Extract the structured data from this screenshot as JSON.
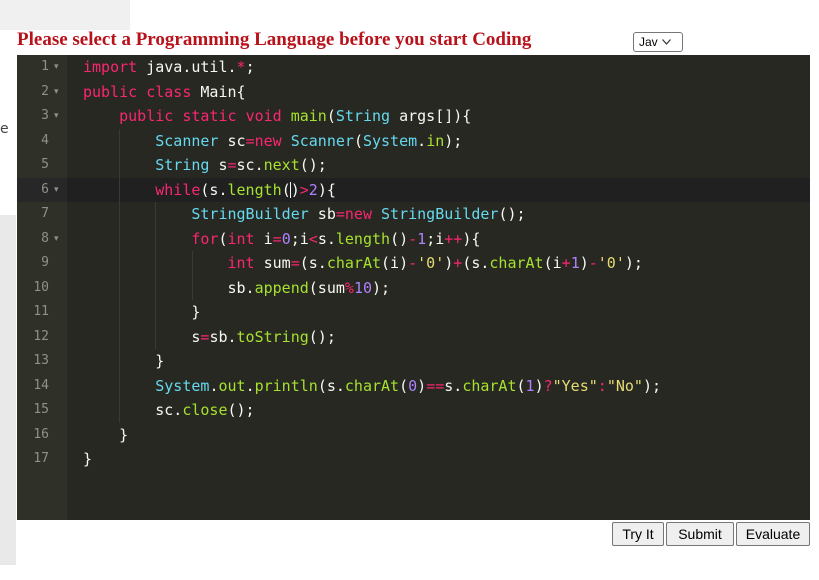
{
  "heading": "Please select a Programming Language before you start Coding",
  "language_select": {
    "selected": "Jav",
    "icon": "chevron-down-icon"
  },
  "editor": {
    "active_line": 6,
    "lines": [
      {
        "n": "1",
        "fold": true,
        "text": "import java.util.*;"
      },
      {
        "n": "2",
        "fold": true,
        "text": "public class Main{"
      },
      {
        "n": "3",
        "fold": true,
        "text": "    public static void main(String args[]){"
      },
      {
        "n": "4",
        "fold": false,
        "text": "        Scanner sc=new Scanner(System.in);"
      },
      {
        "n": "5",
        "fold": false,
        "text": "        String s=sc.next();"
      },
      {
        "n": "6",
        "fold": true,
        "text": "        while(s.length()>2){"
      },
      {
        "n": "7",
        "fold": false,
        "text": "            StringBuilder sb=new StringBuilder();"
      },
      {
        "n": "8",
        "fold": true,
        "text": "            for(int i=0;i<s.length()-1;i++){"
      },
      {
        "n": "9",
        "fold": false,
        "text": "                int sum=(s.charAt(i)-'0')+(s.charAt(i+1)-'0');"
      },
      {
        "n": "10",
        "fold": false,
        "text": "                sb.append(sum%10);"
      },
      {
        "n": "11",
        "fold": false,
        "text": "            }"
      },
      {
        "n": "12",
        "fold": false,
        "text": "            s=sb.toString();"
      },
      {
        "n": "13",
        "fold": false,
        "text": "        }"
      },
      {
        "n": "14",
        "fold": false,
        "text": "        System.out.println(s.charAt(0)==s.charAt(1)?\"Yes\":\"No\");"
      },
      {
        "n": "15",
        "fold": false,
        "text": "        sc.close();"
      },
      {
        "n": "16",
        "fold": false,
        "text": "    }"
      },
      {
        "n": "17",
        "fold": false,
        "text": "}"
      }
    ]
  },
  "buttons": {
    "try_it": "Try It",
    "submit": "Submit",
    "evaluate": "Evaluate"
  },
  "colors": {
    "heading": "#b8121b",
    "editor_bg": "#272822",
    "keyword": "#f92672",
    "type": "#66d9ef",
    "function": "#a6e22e",
    "number": "#ae81ff",
    "string": "#e6db74"
  }
}
